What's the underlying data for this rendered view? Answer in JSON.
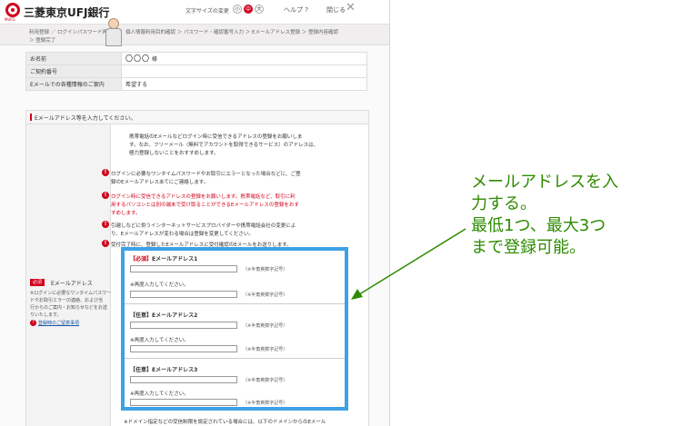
{
  "header": {
    "logo_sub": "MUFG",
    "bank_name": "三菱東京UFJ銀行",
    "font_size_label": "文字サイズの変更",
    "font_sizes": [
      "小",
      "中",
      "大"
    ],
    "help": "ヘルプ ?",
    "close": "閉じる"
  },
  "breadcrumb": {
    "line1": "利用登録 ／ ログインパスワード再登録 ｜ 個人情報利用目的確認 ＞ パスワード・確認番号入力 ＞ Eメールアドレス登録 ＞ 登録内容確認",
    "line2": "＞ 登録完了"
  },
  "info": [
    {
      "label": "お名前",
      "value": "〇〇〇",
      "suffix": "様"
    },
    {
      "label": "ご契約番号",
      "value": ""
    },
    {
      "label": "Eメールでの各種情報のご案内",
      "value": "希望する"
    }
  ],
  "section": {
    "title": "Eメールアドレス等を入力してください。",
    "intro": [
      "携帯電話のEメールなどログイン時に受信できるアドレスの登録をお願いしま",
      "す。なお、フリーメール（無料でアカウントを取得できるサービス）のアドレスは、",
      "極力登録しないことをおすすめします。"
    ],
    "notes": [
      {
        "lines": [
          "ログインに必要なワンタイムパスワードやお取引にエラーとなった場合などに、ご登",
          "録のEメールアドレスあてにご連絡します。"
        ],
        "red": false
      },
      {
        "lines": [
          "ログイン時に受信できるアドレスの登録をお願いします。携帯電話など、取引に利",
          "用するパソコンとは別の端末で受け取ることができるEメールアドレスの登録をおす",
          "すめします。"
        ],
        "red": true
      },
      {
        "lines": [
          "引越しなどに併うインターネットサービスプロバイダーや携帯電話会社の変更によ",
          "り、Eメールアドレスが変わる場合は登録を変更してください。"
        ],
        "red": false
      },
      {
        "lines": [
          "受付完了時に、登録したEメールアドレスに受付確認のEメールをお送りします。"
        ],
        "red": false
      }
    ]
  },
  "left_col": {
    "required_tag": "必須",
    "label": "Eメールアドレス",
    "notes": [
      "※ログインに必要なワンタイムパスワー",
      "ドやお取引エラーの連絡、および当",
      "行からのご案内・お知らせなどをお送",
      "りいたします。"
    ],
    "faq": "登録時のご留意事項"
  },
  "fields": [
    {
      "tag": "【必須】",
      "label": "Eメールアドレス1",
      "hint": "（※半角英数字記号）",
      "reenter": "※再度入力してください。",
      "hint2": "（※半角英数字記号）",
      "value": "",
      "confirm": ""
    },
    {
      "tag": "【任意】",
      "label": "Eメールアドレス2",
      "hint": "（※半角英数字記号）",
      "reenter": "※再度入力してください。",
      "hint2": "（※半角英数字記号）",
      "value": "",
      "confirm": ""
    },
    {
      "tag": "【任意】",
      "label": "Eメールアドレス3",
      "hint": "（※半角英数字記号）",
      "reenter": "※再度入力してください。",
      "hint2": "（※半角英数字記号）",
      "value": "",
      "confirm": ""
    }
  ],
  "bottom_note": "※ドメイン指定などの受信制限を設定されている場合には、以下のドメインからのEメール",
  "annotation": {
    "lines": [
      "メールアドレスを入",
      "力する。",
      "最低1つ、最大3つ",
      "まで登録可能。"
    ],
    "color": "#2e8b00"
  },
  "colors": {
    "accent": "#d0021b",
    "highlight": "#3da2e6"
  }
}
